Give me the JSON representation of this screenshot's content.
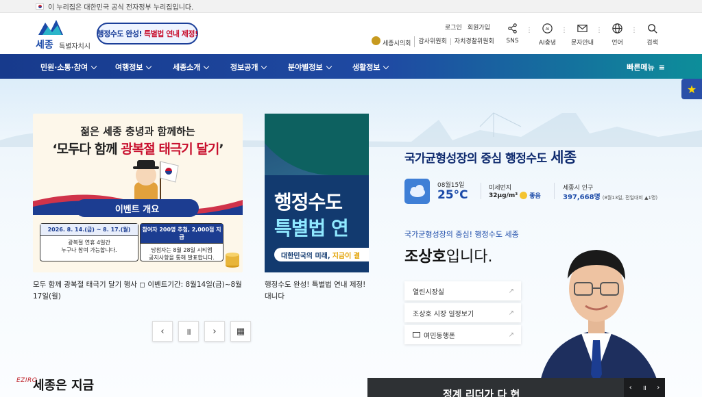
{
  "gov_banner": {
    "text": "이 누리집은 대한민국 공식 전자정부 누리집입니다."
  },
  "logo": {
    "name": "세종",
    "sub": "특별자치시"
  },
  "promo_badge": {
    "text1": "행정수도 완성!",
    "text2": "특별법 연내 제정!"
  },
  "util": {
    "login": "로그인",
    "join": "회원가입",
    "links": [
      "세종시의회",
      "감사위원회",
      "자치경찰위원회"
    ]
  },
  "tools": [
    {
      "label": "SNS",
      "icon": "share-icon"
    },
    {
      "label": "AI충녕",
      "icon": "ai-bot-icon"
    },
    {
      "label": "문자안내",
      "icon": "envelope-icon"
    },
    {
      "label": "언어",
      "icon": "globe-icon"
    },
    {
      "label": "검색",
      "icon": "search-icon"
    }
  ],
  "nav": {
    "items": [
      "민원·소통·참여",
      "여행정보",
      "세종소개",
      "정보공개",
      "분야별정보",
      "생활정보"
    ],
    "quick_menu": "빠른메뉴"
  },
  "slides": [
    {
      "title1": "젊은 세종 충녕과 함께하는",
      "title2_a": "‘모두다 함께 ",
      "title2_b": "광복절 태극기 달기",
      "title2_c": "’",
      "ribbon": "이벤트 개요",
      "box1_head": "2026. 8. 14.(금) ~ 8. 17.(월)",
      "box1_l1": "광복절 연휴 4일간",
      "box1_l2": "누구나 참여 가능합니다.",
      "box2_head": "참여자 200명 추첨, 2,000점 지급",
      "box2_l1": "당첨자는 8월 28일 시티앱",
      "box2_l2": "공지사항을 통해 발표합니다.",
      "caption": "모두 함께 광복절 태극기 달기 행사 ◻ 이벤트기간: 8월14일(금)~8월17일(월)"
    },
    {
      "title1": "행정수도",
      "title2": "특별법 연",
      "bar_a": "대한민국의 미래,",
      "bar_b": "지금이 결",
      "caption": "행정수도 완성! 특별법 연내 제정! 대니다"
    }
  ],
  "controls": {
    "prev": "‹",
    "pause": "॥",
    "next": "›",
    "grid": "▦"
  },
  "tagline": {
    "text": "국가균형성장의 중심 행정수도",
    "city": "세종"
  },
  "weather": {
    "date": "08월15일",
    "temp": "25°C",
    "dust_label": "미세먼지",
    "dust_value": "32μg/m³",
    "dust_grade": "좋음",
    "pop_label": "세종시 인구",
    "pop_value": "397,668명",
    "pop_note": "(8월13일, 전일대비 ▲1명)"
  },
  "mayor": {
    "subtitle": "국가균형성장의 중심! 행정수도 세종",
    "name": "조상호",
    "suffix": "입니다."
  },
  "mayor_links": [
    "열린시장실",
    "조상호 시장 일정보기",
    "여민동행폰"
  ],
  "section": {
    "title": "세종은 지금",
    "watermark": "EZIRO"
  },
  "news": {
    "text": "정계 리더가 다 현"
  },
  "colors": {
    "primary": "#1b4aa8",
    "navy": "#173a8c",
    "teal": "#0d8e9a",
    "red": "#c8102e"
  }
}
